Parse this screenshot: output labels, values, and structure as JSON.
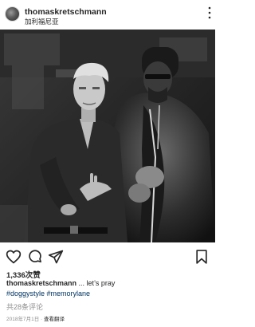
{
  "post": {
    "username": "thomaskretschmann",
    "location": "加利福尼亚",
    "likes": "1,336次赞",
    "caption_user": "thomaskretschmann",
    "caption_text": " ... let’s pray",
    "hashtags": "#doggystyle #memorylane",
    "comments_link": "共28条评论",
    "date": "2018年7月1日",
    "separator": " · ",
    "translate": "查看翻译"
  },
  "icons": {
    "more": "more-vertical-icon",
    "like": "heart-icon",
    "comment": "comment-bubble-icon",
    "share": "send-icon",
    "save": "bookmark-icon"
  },
  "colors": {
    "text": "#262626",
    "muted": "#8e8e8e",
    "hashtag": "#003569"
  }
}
